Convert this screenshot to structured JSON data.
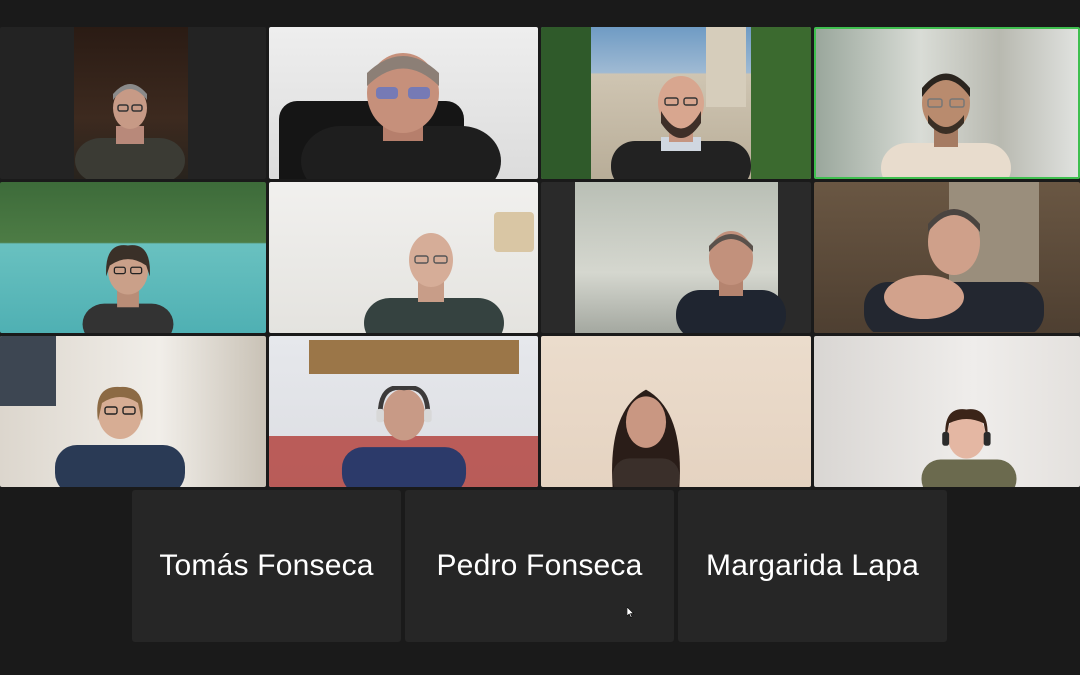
{
  "app": "Video conference gallery view",
  "participants": [
    {
      "id": "p1",
      "kind": "video",
      "skin": "#c79a86",
      "hair": "#8a8a8a",
      "shirt": "#3b3b34",
      "bg": "#2b2b2b",
      "glasses": true
    },
    {
      "id": "p2",
      "kind": "video",
      "skin": "#c6907b",
      "hair": "#8c7f76",
      "shirt": "#1e1e1e",
      "bg": "#e6e6e6",
      "glasses": true
    },
    {
      "id": "p3",
      "kind": "video",
      "skin": "#d8a68f",
      "hair": "#d8a68f",
      "shirt": "#222222",
      "bg": "#b8b2a4",
      "glasses": true
    },
    {
      "id": "p4",
      "kind": "video",
      "skin": "#b98b6e",
      "hair": "#2a241e",
      "shirt": "#e8dccd",
      "bg": "#c8cdc4",
      "glasses": true,
      "active": true
    },
    {
      "id": "p5",
      "kind": "video",
      "skin": "#caa089",
      "hair": "#3a3028",
      "shirt": "#333333",
      "bg": "#6fb8b6",
      "glasses": true
    },
    {
      "id": "p6",
      "kind": "video",
      "skin": "#d6ad98",
      "hair": "#d6ad98",
      "shirt": "#354240",
      "bg": "#ececea",
      "glasses": true
    },
    {
      "id": "p7",
      "kind": "video",
      "skin": "#c2917c",
      "hair": "#5a514b",
      "shirt": "#1f2530",
      "bg": "#b9bfb5",
      "glasses": false
    },
    {
      "id": "p8",
      "kind": "video",
      "skin": "#cfa08a",
      "hair": "#4a4440",
      "shirt": "#232730",
      "bg": "#5b4c3c",
      "glasses": false
    },
    {
      "id": "p9",
      "kind": "video",
      "skin": "#d7ad94",
      "hair": "#8c6a44",
      "shirt": "#2a3a55",
      "bg": "#e8e4dd",
      "glasses": true
    },
    {
      "id": "p10",
      "kind": "video",
      "skin": "#c89a86",
      "hair": "#3c3a3a",
      "shirt": "#2c3a6a",
      "bg": "#ede7e3",
      "glasses": false
    },
    {
      "id": "p11",
      "kind": "video",
      "skin": "#c99782",
      "hair": "#2a1d18",
      "shirt": "#3a2f2a",
      "bg": "#e8d7c6",
      "glasses": false
    },
    {
      "id": "p12",
      "kind": "video",
      "skin": "#e4b7a3",
      "hair": "#3b2418",
      "shirt": "#6b6a4e",
      "bg": "#e5e2df",
      "glasses": false
    }
  ],
  "name_only": [
    {
      "name": "Tomás Fonseca"
    },
    {
      "name": "Pedro Fonseca"
    },
    {
      "name": "Margarida Lapa"
    }
  ]
}
